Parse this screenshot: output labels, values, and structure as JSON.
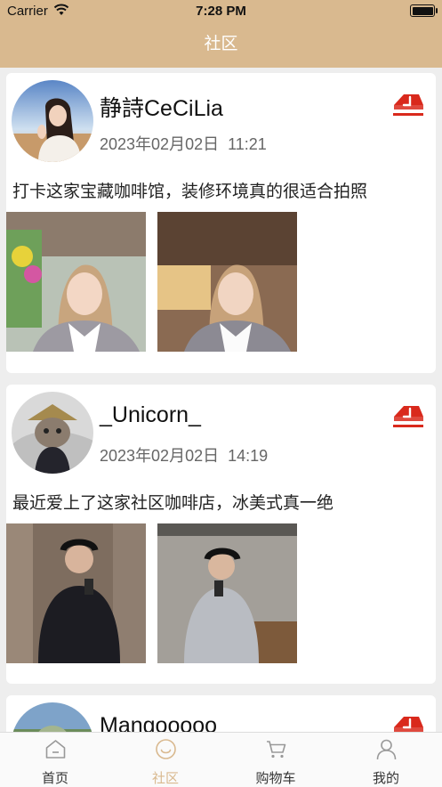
{
  "status_bar": {
    "carrier": "Carrier",
    "time": "7:28 PM"
  },
  "nav": {
    "title": "社区"
  },
  "posts": [
    {
      "username": "静詩CeCiLia",
      "date": "2023年02月02日",
      "time": "11:21",
      "caption": "打卡这家宝藏咖啡馆，装修环境真的很适合拍照"
    },
    {
      "username": "_Unicorn_",
      "date": "2023年02月02日",
      "time": "14:19",
      "caption": "最近爱上了这家社区咖啡店，冰美式真一绝"
    },
    {
      "username": "Mangooooo__"
    }
  ],
  "tabs": [
    {
      "label": "首页",
      "icon": "home-icon"
    },
    {
      "label": "社区",
      "icon": "smiley-icon",
      "active": true
    },
    {
      "label": "购物车",
      "icon": "cart-icon"
    },
    {
      "label": "我的",
      "icon": "person-icon"
    }
  ],
  "colors": {
    "accent": "#d9b98f",
    "share": "#d9291c",
    "background": "#eeeeee"
  }
}
